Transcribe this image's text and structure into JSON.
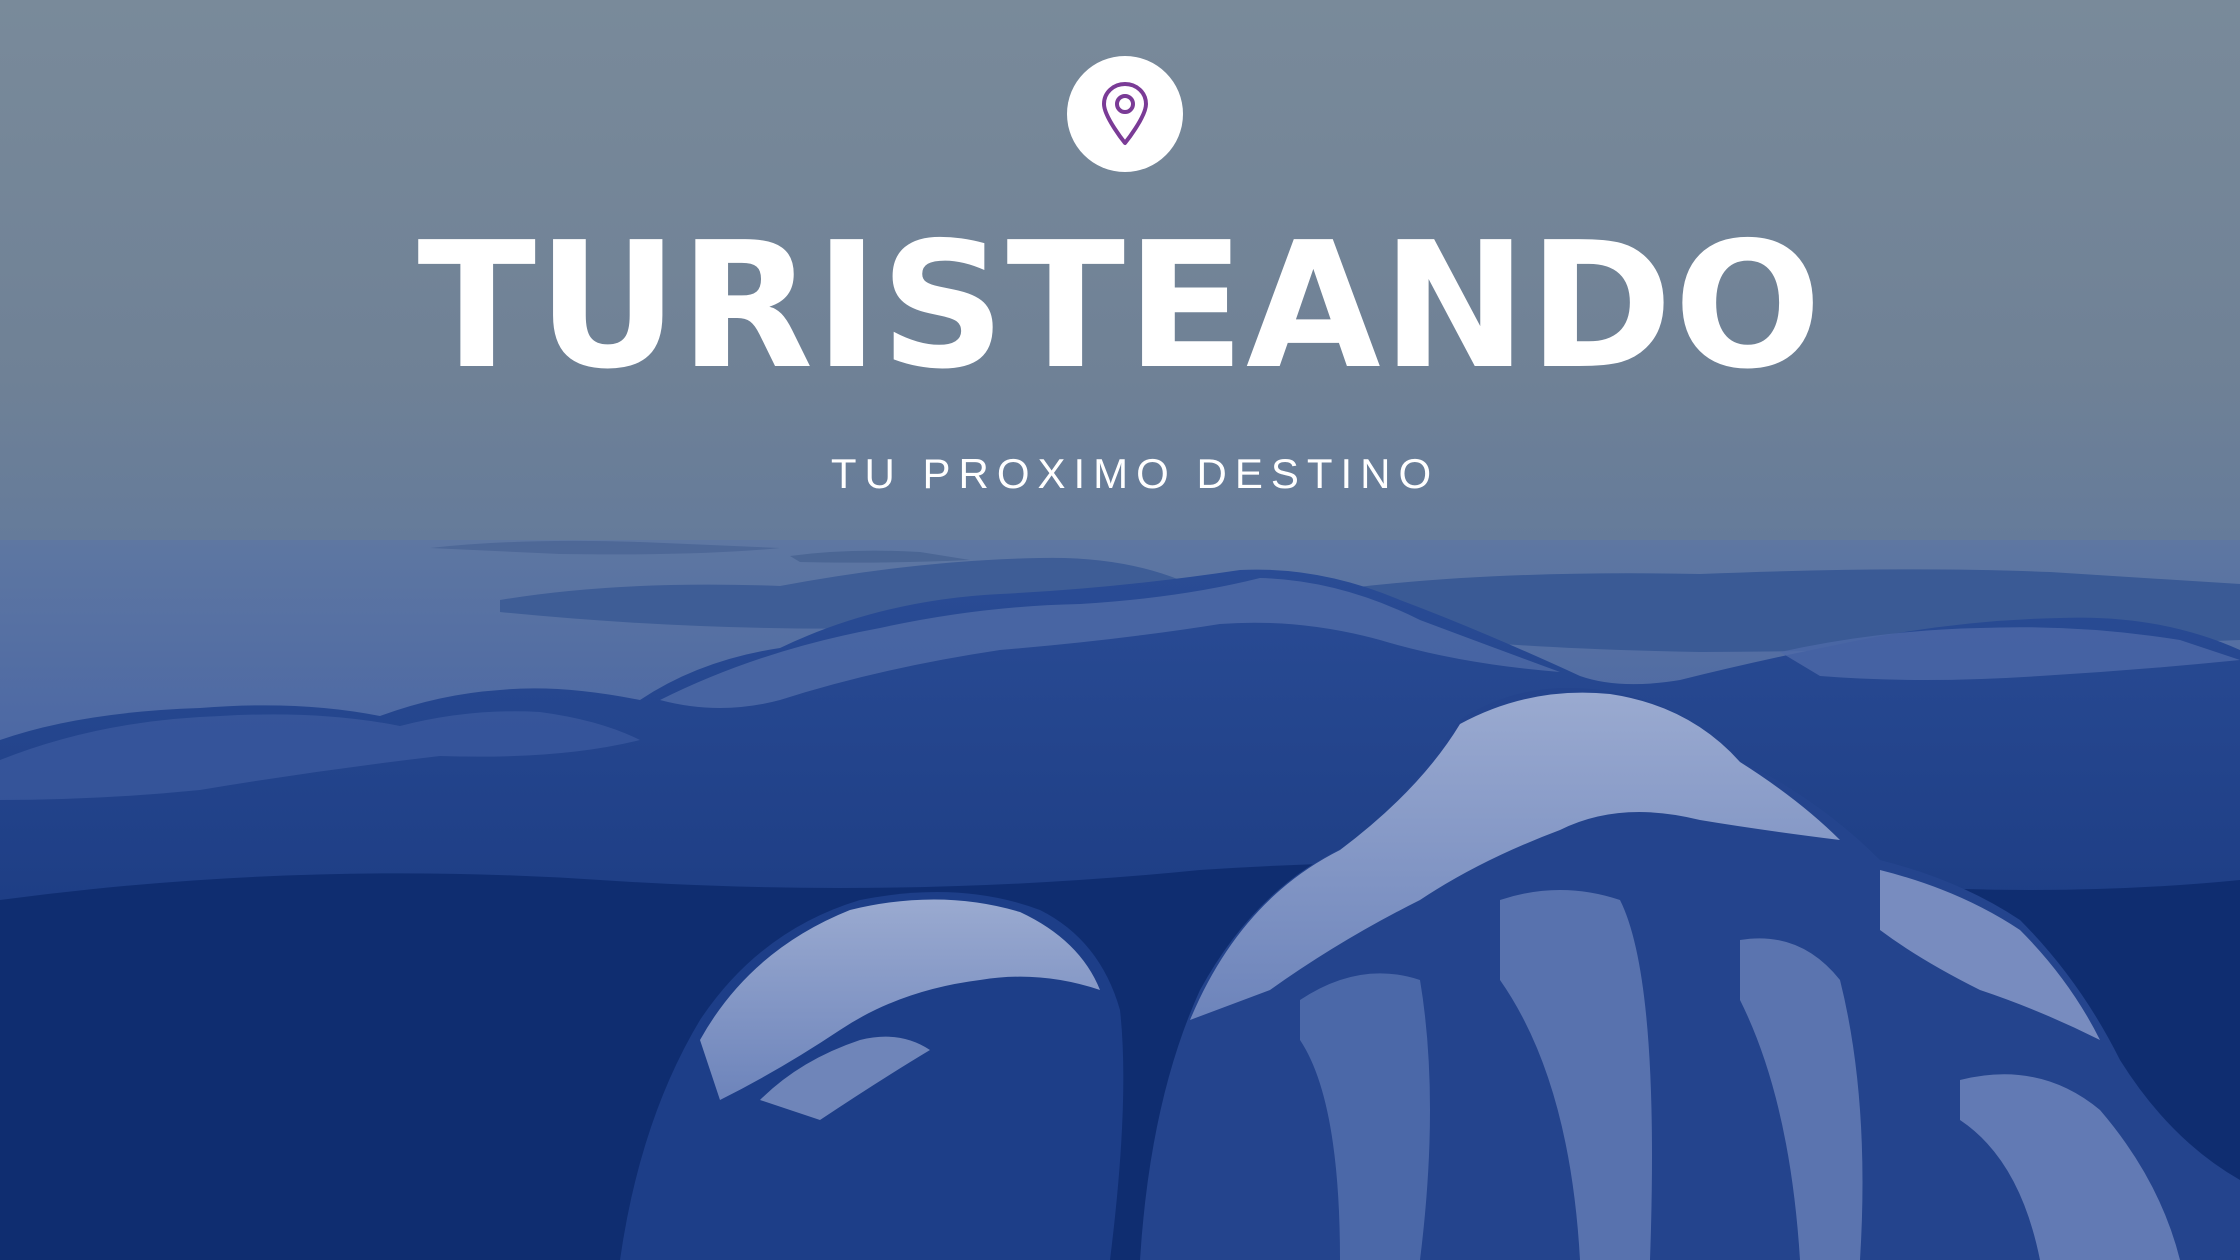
{
  "hero": {
    "title": "TURISTEANDO",
    "subtitle": "TU PROXIMO DESTINO",
    "icon": "location-pin-icon"
  },
  "colors": {
    "sky_top": "#78889a",
    "haze": "#6e82a0",
    "mountain_deep": "#0f2d70",
    "mountain_mid": "#1b3f86",
    "snow": "#7f95c4",
    "text": "#ffffff",
    "pin_stroke": "#7a3b96",
    "badge_bg": "#ffffff"
  }
}
